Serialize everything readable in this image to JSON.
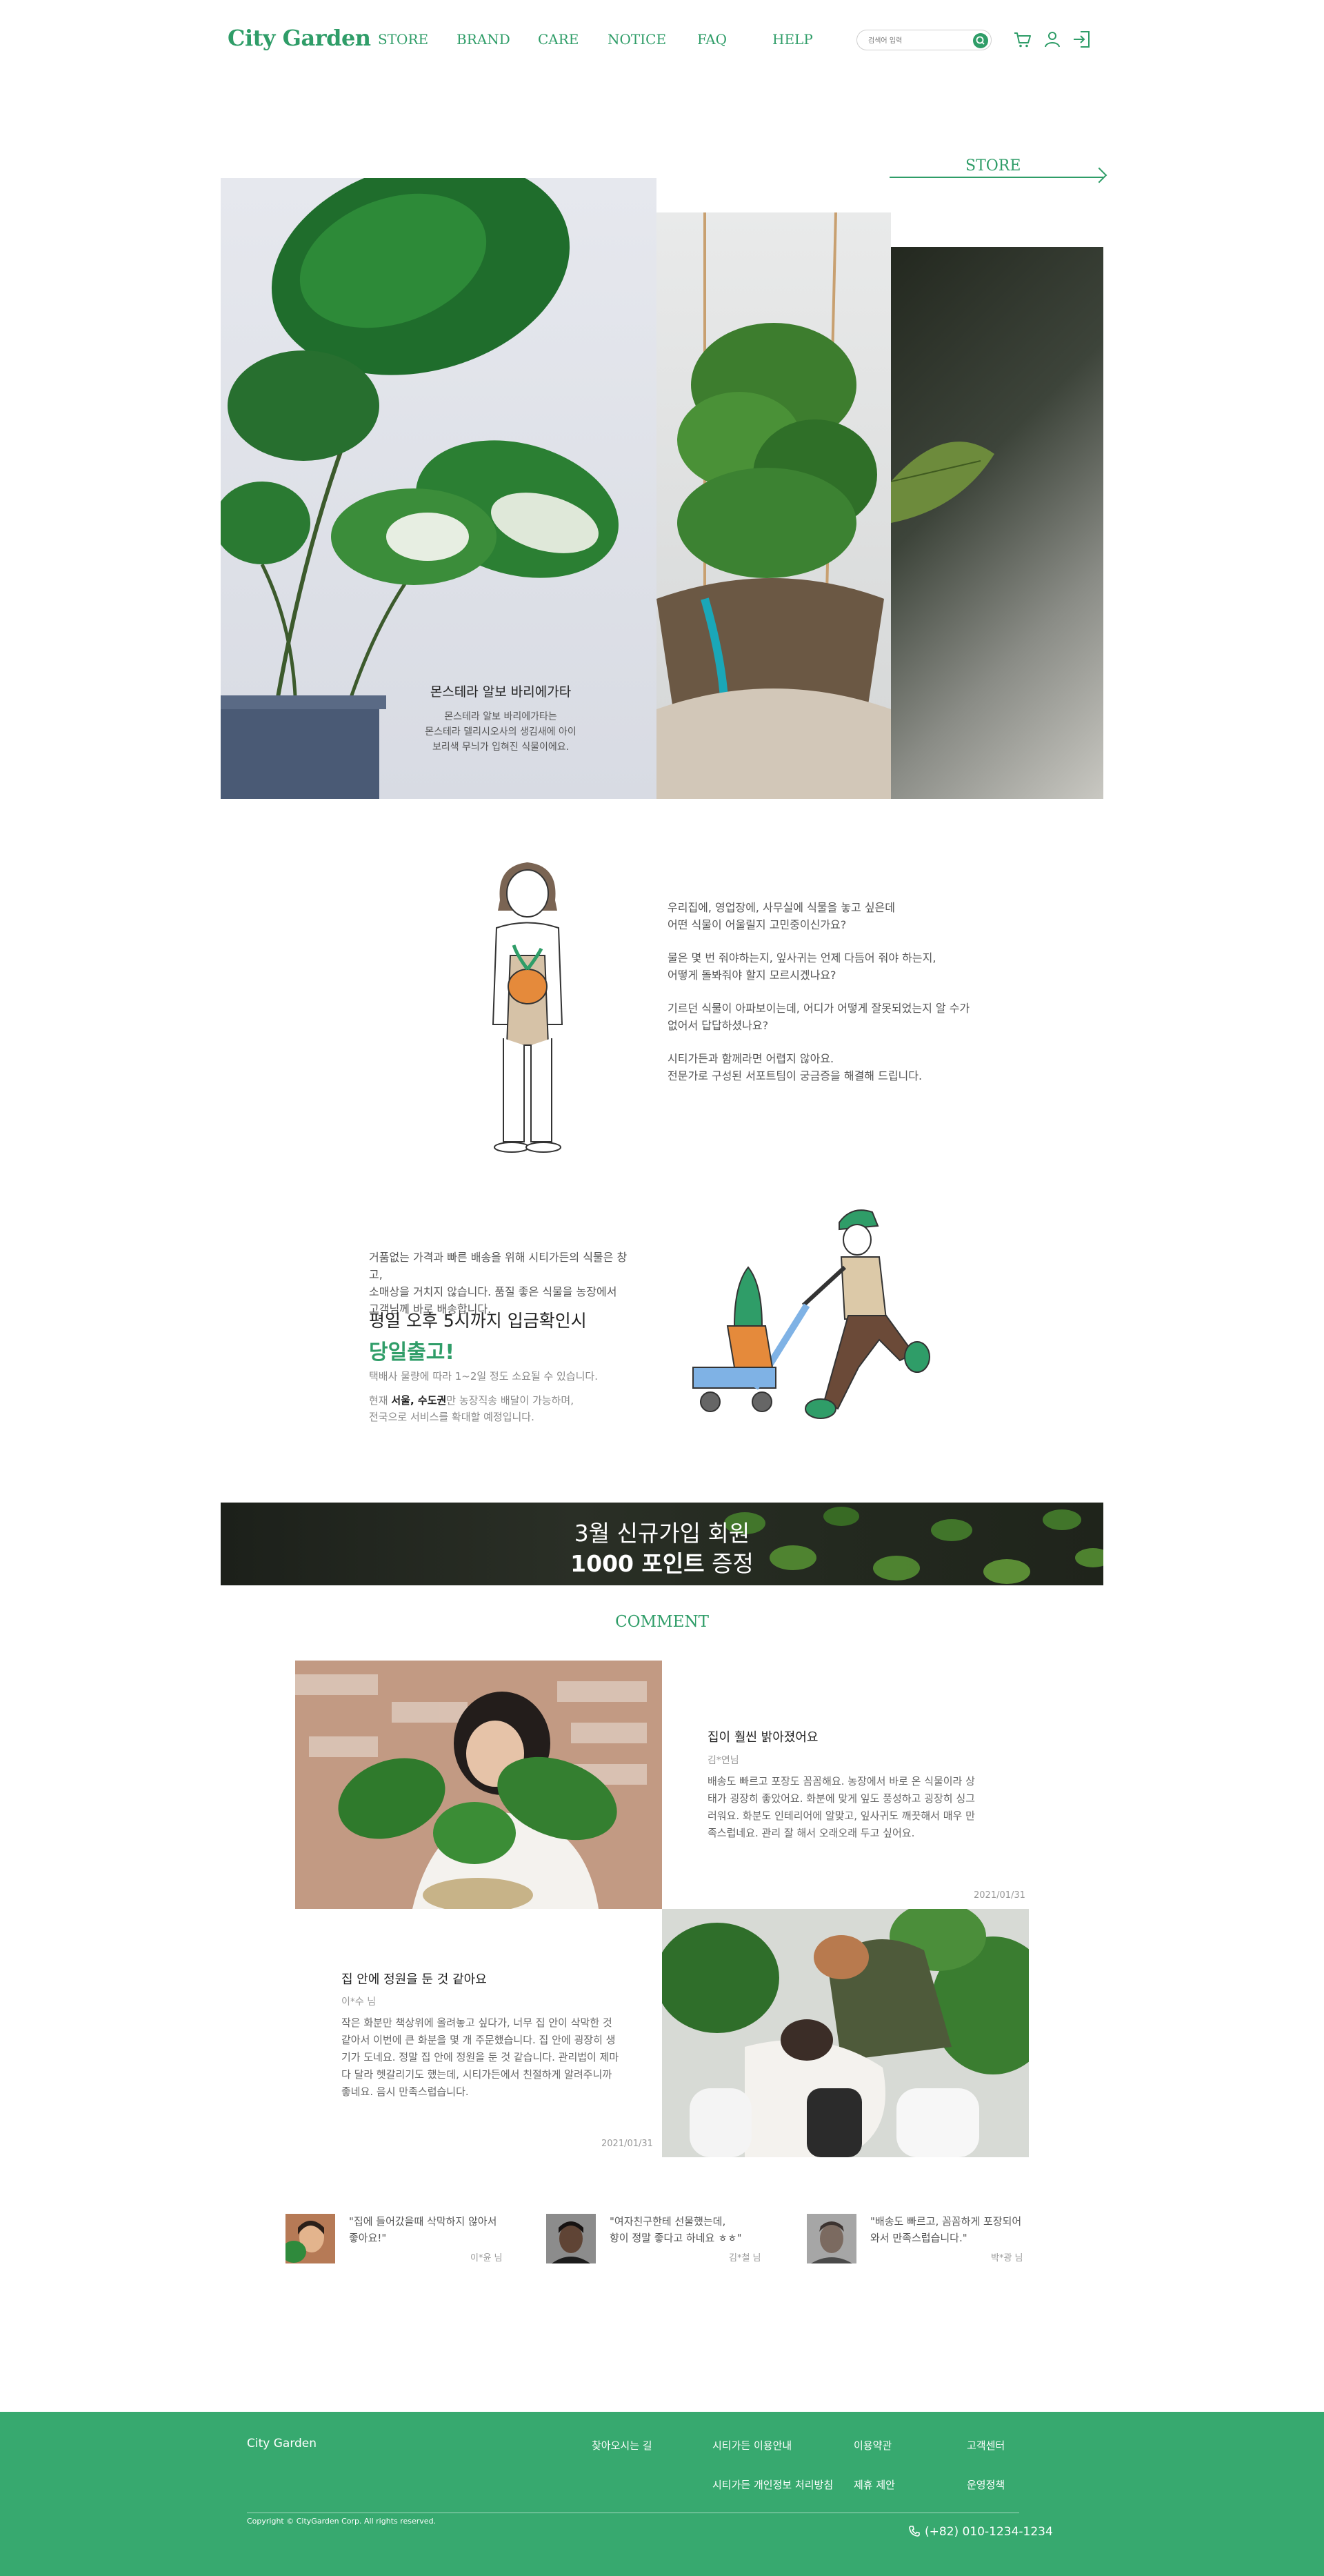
{
  "header": {
    "logo": "City Garden",
    "nav": [
      "STORE",
      "BRAND",
      "CARE",
      "NOTICE",
      "FAQ",
      "HELP"
    ],
    "search_placeholder": "검색어 입력",
    "icons": [
      "search-icon",
      "cart-icon",
      "user-icon",
      "login-icon"
    ]
  },
  "store": {
    "link_label": "STORE",
    "plant_title": "몬스테라 알보 바리에가타",
    "plant_desc": [
      "몬스테라 알보 바리에가타는",
      "몬스테라 델리시오사의 생김새에 아이",
      "보리색 무늬가 입혀진 식물이에요."
    ]
  },
  "intro": {
    "paragraphs": [
      [
        "우리집에, 영업장에, 사무실에 식물을 놓고 싶은데",
        "어떤 식물이 어울릴지 고민중이신가요?"
      ],
      [
        "물은 몇 번 줘야하는지, 잎사귀는 언제 다듬어 줘야 하는지,",
        "어떻게 돌봐줘야 할지 모르시겠나요?"
      ],
      [
        "기르던 식물이 아파보이는데, 어디가 어떻게 잘못되었는지 알 수가",
        "없어서 답답하셨나요?"
      ],
      [
        "시티가든과 함께라면 어렵지 않아요.",
        "전문가로 구성된 서포트팀이 궁금증을 해결해 드립니다."
      ]
    ]
  },
  "delivery": {
    "intro": [
      "거품없는 가격과 빠른 배송을 위해 시티가든의 식물은 창고,",
      "소매상을 거치지 않습니다. 품질 좋은 식물을 농장에서",
      "고객님께 바로 배송합니다."
    ],
    "headline": "평일 오후 5시까지 입금확인시",
    "highlight": "당일출고!",
    "note1": "택배사 물량에 따라 1~2일 정도 소요될 수 있습니다.",
    "note2_prefix": "현재 ",
    "note2_bold": "서울, 수도권",
    "note2_suffix": "만 농장직송 배달이 가능하며,",
    "note3": "전국으로 서비스를 확대할 예정입니다."
  },
  "banner": {
    "line1": "3월 신규가입 회원",
    "line2_bold": "1000 포인트",
    "line2_rest": " 증정"
  },
  "comments": {
    "section_title": "COMMENT",
    "reviews": [
      {
        "title": "집이 훨씬 밝아졌어요",
        "author": "김*연님",
        "body": [
          "배송도 빠르고 포장도 꼼꼼해요. 농장에서 바로 온 식물이라 상",
          "태가 굉장히 좋았어요. 화분에 맞게 잎도 풍성하고 굉장히 싱그",
          "러워요. 화분도 인테리어에 알맞고, 잎사귀도 깨끗해서 매우 만",
          "족스럽네요. 관리 잘 해서 오래오래 두고 싶어요."
        ],
        "date": "2021/01/31"
      },
      {
        "title": "집 안에 정원을 둔 것 같아요",
        "author": "이*수 님",
        "body": [
          "작은 화분만 책상위에 올려놓고 싶다가, 너무 집 안이 삭막한 것",
          "같아서 이번에 큰 화분을 몇 개 주문했습니다. 집 안에 굉장히 생",
          "기가 도네요. 정말 집 안에 정원을 둔 것 같습니다. 관리법이 제마",
          "다 달라 헷갈리기도 했는데, 시티가든에서 친절하게 알려주니까",
          "좋네요. 음시 만족스럽습니다."
        ],
        "date": "2021/01/31"
      }
    ],
    "mini": [
      {
        "quote": [
          "\"집에 들어갔을때 삭막하지 않아서",
          "좋아요!\""
        ],
        "name": "이*윤 님"
      },
      {
        "quote": [
          "\"여자친구한테 선물했는데,",
          "향이 정말 좋다고 하네요 ㅎㅎ\""
        ],
        "name": "김*철 님"
      },
      {
        "quote": [
          "\"배송도 빠르고, 꼼꼼하게 포장되어",
          "와서 만족스럽습니다.\""
        ],
        "name": "박*광 님"
      }
    ]
  },
  "footer": {
    "brand": "City Garden",
    "links_row1": [
      "찾아오시는 길",
      "시티가든 이용안내",
      "이용약관",
      "고객센터"
    ],
    "links_row2": [
      "시티가든 개인정보 처리방침",
      "제휴 제안",
      "운영정책"
    ],
    "copyright": "Copyright © CityGarden Corp. All rights reserved.",
    "phone": "(+82) 010-1234-1234"
  },
  "colors": {
    "brand_green": "#2f9d68",
    "footer_green": "#37a96f"
  }
}
